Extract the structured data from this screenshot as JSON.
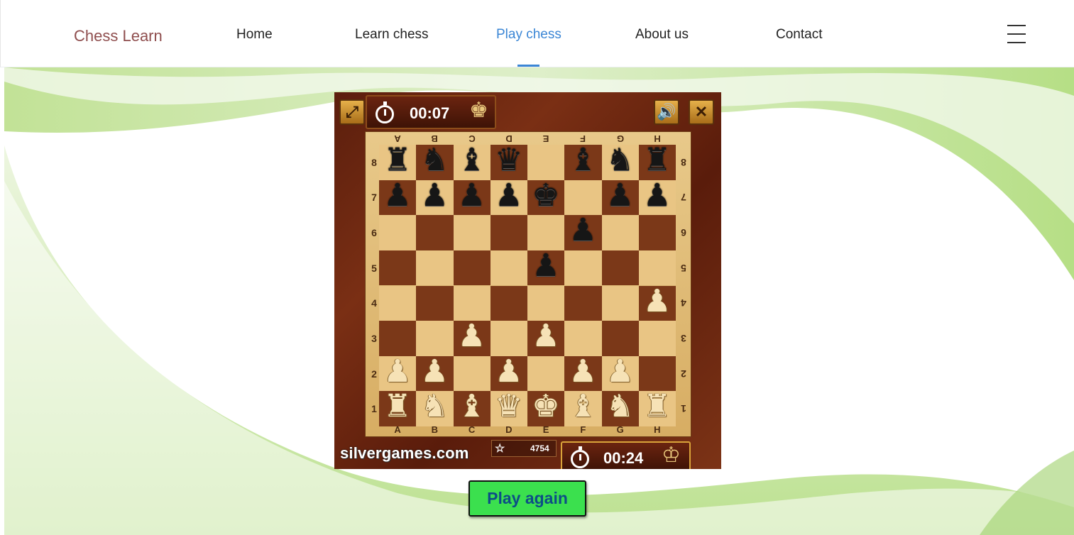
{
  "brand": "Chess Learn",
  "nav": {
    "items": [
      {
        "label": "Home"
      },
      {
        "label": "Learn chess"
      },
      {
        "label": "Play chess",
        "active": true
      },
      {
        "label": "About us"
      },
      {
        "label": "Contact"
      }
    ],
    "menu_icon": "hamburger-menu-icon"
  },
  "game": {
    "top_timer": "00:07",
    "bottom_timer": "00:24",
    "score": "4754",
    "site": "silvergames.com",
    "controls": [
      "fullscreen-icon",
      "sound-icon",
      "close-icon"
    ],
    "files": [
      "A",
      "B",
      "C",
      "D",
      "E",
      "F",
      "G",
      "H"
    ],
    "ranks": [
      "8",
      "7",
      "6",
      "5",
      "4",
      "3",
      "2",
      "1"
    ],
    "board": [
      [
        "bR",
        "bN",
        "bB",
        "bQ",
        "",
        "bB",
        "bN",
        "bR"
      ],
      [
        "bP",
        "bP",
        "bP",
        "bP",
        "bK",
        "",
        "bP",
        "bP"
      ],
      [
        "",
        "",
        "",
        "",
        "",
        "bP",
        "",
        ""
      ],
      [
        "",
        "",
        "",
        "",
        "bP",
        "",
        "",
        ""
      ],
      [
        "",
        "",
        "",
        "",
        "",
        "",
        "",
        "wP"
      ],
      [
        "",
        "",
        "wP",
        "",
        "wP",
        "",
        "",
        ""
      ],
      [
        "wP",
        "wP",
        "",
        "wP",
        "",
        "wP",
        "wP",
        ""
      ],
      [
        "wR",
        "wN",
        "wB",
        "wQ",
        "wK",
        "wB",
        "wN",
        "wR"
      ]
    ],
    "accent_colors": {
      "light_square": "#e9c584",
      "dark_square": "#7b3818"
    }
  },
  "play_again_label": "Play again"
}
